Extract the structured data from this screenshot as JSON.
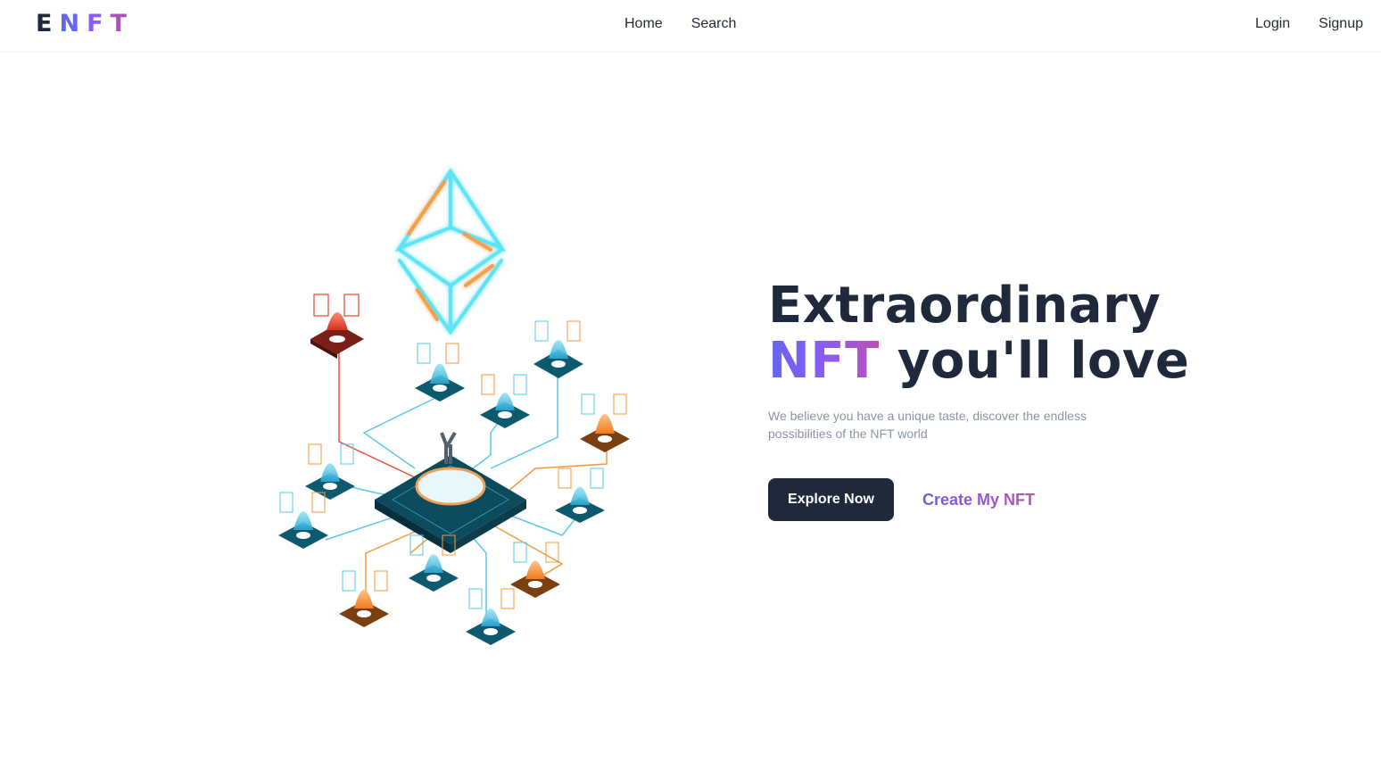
{
  "brand": {
    "letters": [
      "E",
      "N",
      "F",
      "T"
    ],
    "letter_colors": [
      "#1e293b",
      "#6366f1",
      "#8b5cf6",
      "#a855b7"
    ]
  },
  "nav": {
    "center": [
      {
        "label": "Home"
      },
      {
        "label": "Search"
      }
    ],
    "right": [
      {
        "label": "Login"
      },
      {
        "label": "Signup"
      }
    ]
  },
  "hero": {
    "headline_line1": "Extraordinary",
    "headline_accent": "NFT",
    "headline_rest": " you'll love",
    "subtitle": "We believe you have a unique taste, discover the endless possibilities of the NFT world",
    "primary_cta": "Explore Now",
    "secondary_cta": "Create My NFT",
    "illustration_icon": "ethereum-network-illustration"
  },
  "colors": {
    "primary_dark": "#1e293b",
    "accent_gradient_start": "#6366f1",
    "accent_gradient_end": "#c04fb5",
    "illustration_cyan": "#4fd8ef",
    "illustration_orange": "#f59a3e",
    "illustration_red": "#e04a3a"
  }
}
